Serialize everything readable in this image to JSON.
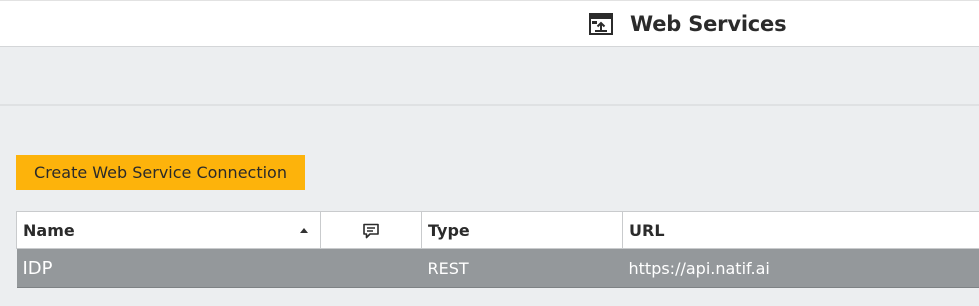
{
  "header": {
    "title": "Web Services",
    "icon": "web-services-icon"
  },
  "actions": {
    "create_label": "Create Web Service Connection",
    "create_color": "#fdb30b"
  },
  "table": {
    "columns": [
      {
        "label": "Name",
        "sorted": "ascending"
      },
      {
        "label": "",
        "icon": "comment-icon"
      },
      {
        "label": "Type"
      },
      {
        "label": "URL"
      }
    ],
    "rows": [
      {
        "name": "IDP",
        "comment": "",
        "type": "REST",
        "url": "https://api.natif.ai"
      }
    ],
    "selected_row_color": "#94989b"
  }
}
